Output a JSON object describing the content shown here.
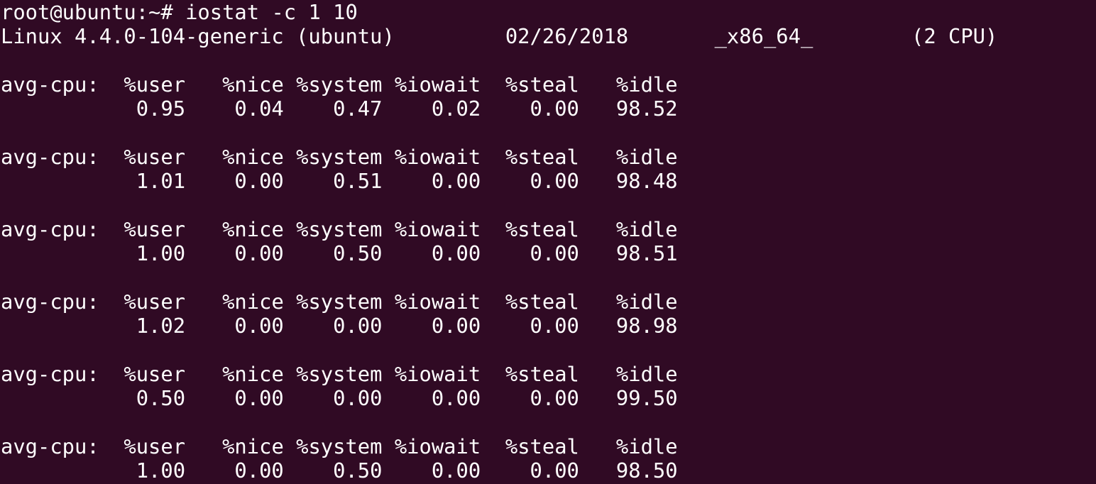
{
  "terminal": {
    "background": "#300a24",
    "foreground": "#ffffff",
    "prompt": "root@ubuntu:~#",
    "command": "iostat -c 1 10",
    "system_info": {
      "kernel": "Linux 4.4.0-104-generic (ubuntu)",
      "date": "02/26/2018",
      "arch": "_x86_64_",
      "cpus": "(2 CPU)"
    },
    "header": {
      "label": "avg-cpu:",
      "cols": [
        "%user",
        "%nice",
        "%system",
        "%iowait",
        "%steal",
        "%idle"
      ]
    },
    "samples": [
      [
        "0.95",
        "0.04",
        "0.47",
        "0.02",
        "0.00",
        "98.52"
      ],
      [
        "1.01",
        "0.00",
        "0.51",
        "0.00",
        "0.00",
        "98.48"
      ],
      [
        "1.00",
        "0.00",
        "0.50",
        "0.00",
        "0.00",
        "98.51"
      ],
      [
        "1.02",
        "0.00",
        "0.00",
        "0.00",
        "0.00",
        "98.98"
      ],
      [
        "0.50",
        "0.00",
        "0.00",
        "0.00",
        "0.00",
        "99.50"
      ],
      [
        "1.00",
        "0.00",
        "0.50",
        "0.00",
        "0.00",
        "98.50"
      ]
    ]
  }
}
